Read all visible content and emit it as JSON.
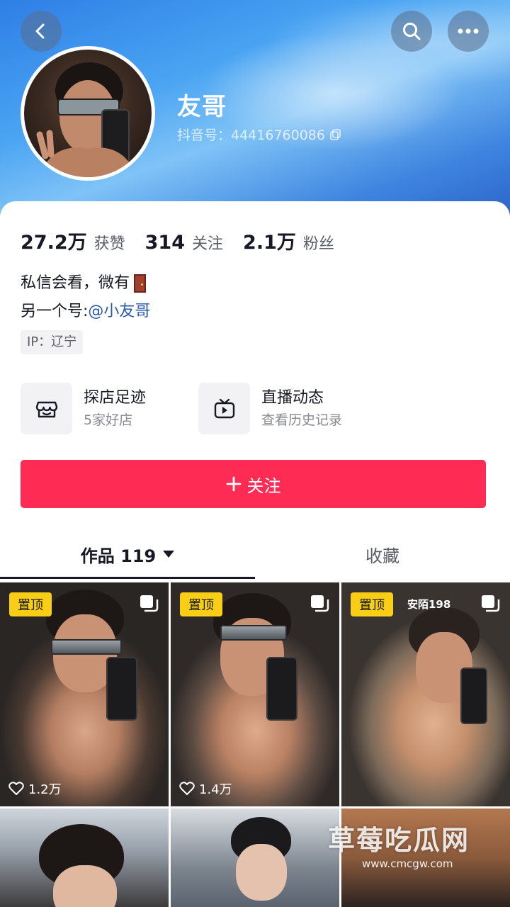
{
  "profile": {
    "nickname": "友哥",
    "douyin_id": "抖音号：44416760086"
  },
  "stats": [
    {
      "num": "27.2万",
      "label": "获赞"
    },
    {
      "num": "314",
      "label": "关注"
    },
    {
      "num": "2.1万",
      "label": "粉丝"
    }
  ],
  "bio": {
    "line1": "私信会看，微有",
    "line2_prefix": "另一个号:",
    "line2_mention": "@小友哥"
  },
  "ip_tag": "IP：辽宁",
  "features": [
    {
      "title": "探店足迹",
      "sub": "5家好店",
      "icon": "store-icon"
    },
    {
      "title": "直播动态",
      "sub": "查看历史记录",
      "icon": "tv-icon"
    }
  ],
  "follow_button": "关注",
  "tabs": {
    "works": "作品 119",
    "collect": "收藏"
  },
  "grid": [
    {
      "pinned": "置顶",
      "likes": "1.2万"
    },
    {
      "pinned": "置顶",
      "likes": "1.4万"
    },
    {
      "pinned": "置顶",
      "overlay_text": "安陌198"
    }
  ],
  "watermark": {
    "title": "草莓吃瓜网",
    "url": "www.cmcgw.com"
  },
  "colors": {
    "accent": "#fe2c55",
    "pin_badge": "#face15",
    "mention": "#2a5aa8"
  }
}
